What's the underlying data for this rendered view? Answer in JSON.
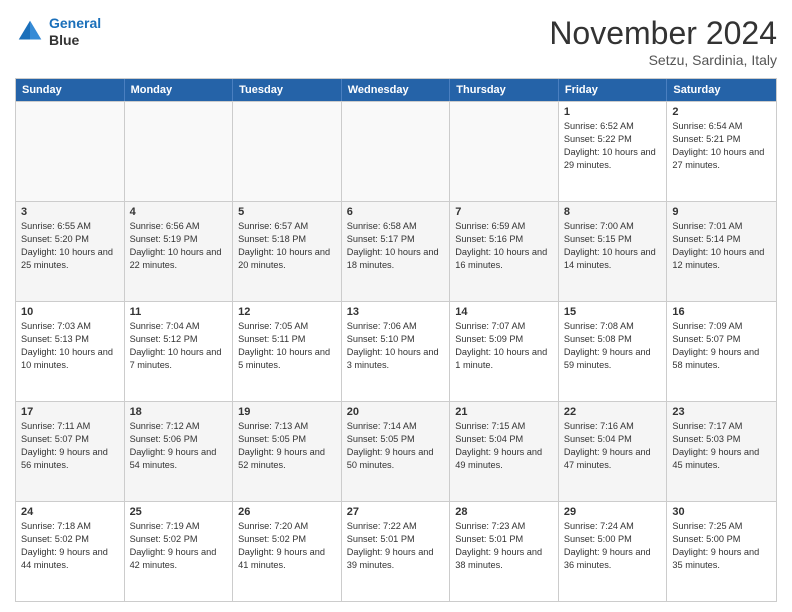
{
  "logo": {
    "line1": "General",
    "line2": "Blue"
  },
  "title": "November 2024",
  "subtitle": "Setzu, Sardinia, Italy",
  "days_of_week": [
    "Sunday",
    "Monday",
    "Tuesday",
    "Wednesday",
    "Thursday",
    "Friday",
    "Saturday"
  ],
  "rows": [
    {
      "alt": false,
      "cells": [
        {
          "day": "",
          "empty": true,
          "info": ""
        },
        {
          "day": "",
          "empty": true,
          "info": ""
        },
        {
          "day": "",
          "empty": true,
          "info": ""
        },
        {
          "day": "",
          "empty": true,
          "info": ""
        },
        {
          "day": "",
          "empty": true,
          "info": ""
        },
        {
          "day": "1",
          "empty": false,
          "info": "Sunrise: 6:52 AM\nSunset: 5:22 PM\nDaylight: 10 hours and 29 minutes."
        },
        {
          "day": "2",
          "empty": false,
          "info": "Sunrise: 6:54 AM\nSunset: 5:21 PM\nDaylight: 10 hours and 27 minutes."
        }
      ]
    },
    {
      "alt": true,
      "cells": [
        {
          "day": "3",
          "empty": false,
          "info": "Sunrise: 6:55 AM\nSunset: 5:20 PM\nDaylight: 10 hours and 25 minutes."
        },
        {
          "day": "4",
          "empty": false,
          "info": "Sunrise: 6:56 AM\nSunset: 5:19 PM\nDaylight: 10 hours and 22 minutes."
        },
        {
          "day": "5",
          "empty": false,
          "info": "Sunrise: 6:57 AM\nSunset: 5:18 PM\nDaylight: 10 hours and 20 minutes."
        },
        {
          "day": "6",
          "empty": false,
          "info": "Sunrise: 6:58 AM\nSunset: 5:17 PM\nDaylight: 10 hours and 18 minutes."
        },
        {
          "day": "7",
          "empty": false,
          "info": "Sunrise: 6:59 AM\nSunset: 5:16 PM\nDaylight: 10 hours and 16 minutes."
        },
        {
          "day": "8",
          "empty": false,
          "info": "Sunrise: 7:00 AM\nSunset: 5:15 PM\nDaylight: 10 hours and 14 minutes."
        },
        {
          "day": "9",
          "empty": false,
          "info": "Sunrise: 7:01 AM\nSunset: 5:14 PM\nDaylight: 10 hours and 12 minutes."
        }
      ]
    },
    {
      "alt": false,
      "cells": [
        {
          "day": "10",
          "empty": false,
          "info": "Sunrise: 7:03 AM\nSunset: 5:13 PM\nDaylight: 10 hours and 10 minutes."
        },
        {
          "day": "11",
          "empty": false,
          "info": "Sunrise: 7:04 AM\nSunset: 5:12 PM\nDaylight: 10 hours and 7 minutes."
        },
        {
          "day": "12",
          "empty": false,
          "info": "Sunrise: 7:05 AM\nSunset: 5:11 PM\nDaylight: 10 hours and 5 minutes."
        },
        {
          "day": "13",
          "empty": false,
          "info": "Sunrise: 7:06 AM\nSunset: 5:10 PM\nDaylight: 10 hours and 3 minutes."
        },
        {
          "day": "14",
          "empty": false,
          "info": "Sunrise: 7:07 AM\nSunset: 5:09 PM\nDaylight: 10 hours and 1 minute."
        },
        {
          "day": "15",
          "empty": false,
          "info": "Sunrise: 7:08 AM\nSunset: 5:08 PM\nDaylight: 9 hours and 59 minutes."
        },
        {
          "day": "16",
          "empty": false,
          "info": "Sunrise: 7:09 AM\nSunset: 5:07 PM\nDaylight: 9 hours and 58 minutes."
        }
      ]
    },
    {
      "alt": true,
      "cells": [
        {
          "day": "17",
          "empty": false,
          "info": "Sunrise: 7:11 AM\nSunset: 5:07 PM\nDaylight: 9 hours and 56 minutes."
        },
        {
          "day": "18",
          "empty": false,
          "info": "Sunrise: 7:12 AM\nSunset: 5:06 PM\nDaylight: 9 hours and 54 minutes."
        },
        {
          "day": "19",
          "empty": false,
          "info": "Sunrise: 7:13 AM\nSunset: 5:05 PM\nDaylight: 9 hours and 52 minutes."
        },
        {
          "day": "20",
          "empty": false,
          "info": "Sunrise: 7:14 AM\nSunset: 5:05 PM\nDaylight: 9 hours and 50 minutes."
        },
        {
          "day": "21",
          "empty": false,
          "info": "Sunrise: 7:15 AM\nSunset: 5:04 PM\nDaylight: 9 hours and 49 minutes."
        },
        {
          "day": "22",
          "empty": false,
          "info": "Sunrise: 7:16 AM\nSunset: 5:04 PM\nDaylight: 9 hours and 47 minutes."
        },
        {
          "day": "23",
          "empty": false,
          "info": "Sunrise: 7:17 AM\nSunset: 5:03 PM\nDaylight: 9 hours and 45 minutes."
        }
      ]
    },
    {
      "alt": false,
      "cells": [
        {
          "day": "24",
          "empty": false,
          "info": "Sunrise: 7:18 AM\nSunset: 5:02 PM\nDaylight: 9 hours and 44 minutes."
        },
        {
          "day": "25",
          "empty": false,
          "info": "Sunrise: 7:19 AM\nSunset: 5:02 PM\nDaylight: 9 hours and 42 minutes."
        },
        {
          "day": "26",
          "empty": false,
          "info": "Sunrise: 7:20 AM\nSunset: 5:02 PM\nDaylight: 9 hours and 41 minutes."
        },
        {
          "day": "27",
          "empty": false,
          "info": "Sunrise: 7:22 AM\nSunset: 5:01 PM\nDaylight: 9 hours and 39 minutes."
        },
        {
          "day": "28",
          "empty": false,
          "info": "Sunrise: 7:23 AM\nSunset: 5:01 PM\nDaylight: 9 hours and 38 minutes."
        },
        {
          "day": "29",
          "empty": false,
          "info": "Sunrise: 7:24 AM\nSunset: 5:00 PM\nDaylight: 9 hours and 36 minutes."
        },
        {
          "day": "30",
          "empty": false,
          "info": "Sunrise: 7:25 AM\nSunset: 5:00 PM\nDaylight: 9 hours and 35 minutes."
        }
      ]
    }
  ]
}
